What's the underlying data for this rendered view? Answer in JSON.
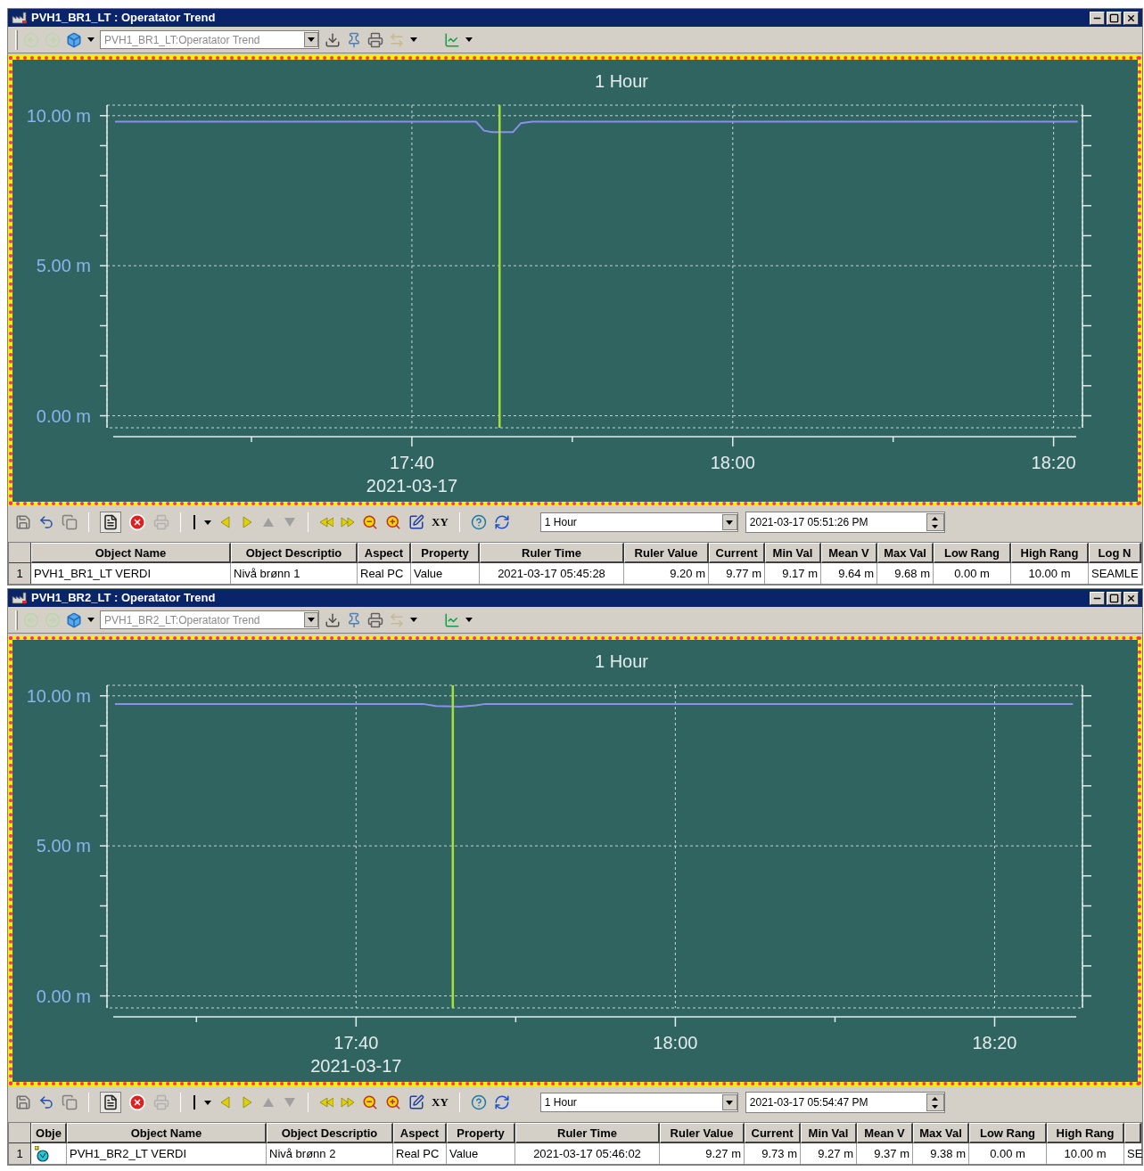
{
  "windows": [
    {
      "title": "PVH1_BR1_LT : Operatator Trend",
      "address": "PVH1_BR1_LT:Operatator Trend",
      "chart": {
        "chart_data": {
          "type": "line",
          "title": "1 Hour",
          "xlabel": "2021-03-17",
          "x": [
            17.3583,
            17.7333,
            17.7417,
            17.75,
            17.7717,
            17.78,
            17.7917,
            18.3583
          ],
          "series": [
            {
              "color": "#8c90e8",
              "values": [
                9.8,
                9.8,
                9.5,
                9.45,
                9.45,
                9.75,
                9.8,
                9.8
              ]
            }
          ],
          "grid": true,
          "xlim": [
            17.35,
            18.3633
          ],
          "ylim": [
            -0.4,
            10.35
          ],
          "xticks": [
            {
              "value": 17.6667,
              "label": "17:40"
            },
            {
              "value": 18.0,
              "label": "18:00"
            },
            {
              "value": 18.3333,
              "label": "18:20"
            }
          ],
          "yticks": [
            {
              "value": 0,
              "label": "0.00 m"
            },
            {
              "value": 5,
              "label": "5.00 m"
            },
            {
              "value": 10,
              "label": "10.00 m"
            }
          ],
          "ref_lines": [
            {
              "axis": "x",
              "value": 17.7578,
              "color": "#a6e03c"
            }
          ]
        }
      },
      "xy_label": "XY",
      "range": "1 Hour",
      "datetime": "2021-03-17 05:51:26 PM",
      "table": {
        "columns": [
          {
            "kind": "name",
            "label": "Object Name"
          },
          {
            "kind": "desc",
            "label": "Object Descriptio"
          },
          {
            "kind": "aspect",
            "label": "Aspect"
          },
          {
            "kind": "property",
            "label": "Property"
          },
          {
            "kind": "rtime",
            "label": "Ruler Time"
          },
          {
            "kind": "rvalue",
            "label": "Ruler Value"
          },
          {
            "kind": "stat",
            "label": "Current"
          },
          {
            "kind": "stat",
            "label": "Min Val"
          },
          {
            "kind": "stat",
            "label": "Mean V"
          },
          {
            "kind": "stat",
            "label": "Max Val"
          },
          {
            "kind": "range",
            "label": "Low Rang"
          },
          {
            "kind": "range",
            "label": "High Rang"
          },
          {
            "kind": "log",
            "label": "Log N"
          }
        ],
        "rows": [
          {
            "number": "1",
            "cells": [
              "PVH1_BR1_LT VERDI",
              "Nivå brønn 1",
              "Real PC",
              "Value",
              "2021-03-17 05:45:28",
              "9.20 m",
              "9.77 m",
              "9.17 m",
              "9.64 m",
              "9.68 m",
              "0.00 m",
              "10.00 m",
              "SEAMLE"
            ]
          }
        ]
      }
    },
    {
      "title": "PVH1_BR2_LT : Operatator Trend",
      "address": "PVH1_BR2_LT:Operatator Trend",
      "chart": {
        "chart_data": {
          "type": "line",
          "title": "1 Hour",
          "xlabel": "2021-03-17",
          "x": [
            17.415,
            17.7367,
            17.75,
            17.775,
            17.7917,
            17.8017,
            18.415
          ],
          "series": [
            {
              "color": "#8c90e8",
              "values": [
                9.73,
                9.73,
                9.66,
                9.64,
                9.68,
                9.73,
                9.73
              ]
            }
          ],
          "grid": true,
          "xlim": [
            17.4067,
            18.425
          ],
          "ylim": [
            -0.4,
            10.35
          ],
          "xticks": [
            {
              "value": 17.6667,
              "label": "17:40"
            },
            {
              "value": 18.0,
              "label": "18:00"
            },
            {
              "value": 18.3333,
              "label": "18:20"
            }
          ],
          "yticks": [
            {
              "value": 0,
              "label": "0.00 m"
            },
            {
              "value": 5,
              "label": "5.00 m"
            },
            {
              "value": 10,
              "label": "10.00 m"
            }
          ],
          "ref_lines": [
            {
              "axis": "x",
              "value": 17.7677,
              "color": "#a6e03c"
            }
          ]
        }
      },
      "xy_label": "XY",
      "range": "1 Hour",
      "datetime": "2021-03-17 05:54:47 PM",
      "table": {
        "columns": [
          {
            "kind": "icon",
            "label": "Obje"
          },
          {
            "kind": "name",
            "label": "Object Name"
          },
          {
            "kind": "desc",
            "label": "Object Descriptio"
          },
          {
            "kind": "aspect",
            "label": "Aspect"
          },
          {
            "kind": "property",
            "label": "Property"
          },
          {
            "kind": "rtime",
            "label": "Ruler Time"
          },
          {
            "kind": "rvalue",
            "label": "Ruler Value"
          },
          {
            "kind": "stat",
            "label": "Current"
          },
          {
            "kind": "stat",
            "label": "Min Val"
          },
          {
            "kind": "stat",
            "label": "Mean V"
          },
          {
            "kind": "stat",
            "label": "Max Val"
          },
          {
            "kind": "range",
            "label": "Low Rang"
          },
          {
            "kind": "range",
            "label": "High Rang"
          },
          {
            "kind": "log"
          }
        ],
        "rows": [
          {
            "number": "1",
            "cells": [
              "",
              "PVH1_BR2_LT VERDI",
              "Nivå brønn 2",
              "Real PC",
              "Value",
              "2021-03-17 05:46:02",
              "9.27 m",
              "9.73 m",
              "9.27 m",
              "9.37 m",
              "9.38 m",
              "0.00 m",
              "10.00 m",
              "SE"
            ]
          }
        ]
      }
    }
  ]
}
